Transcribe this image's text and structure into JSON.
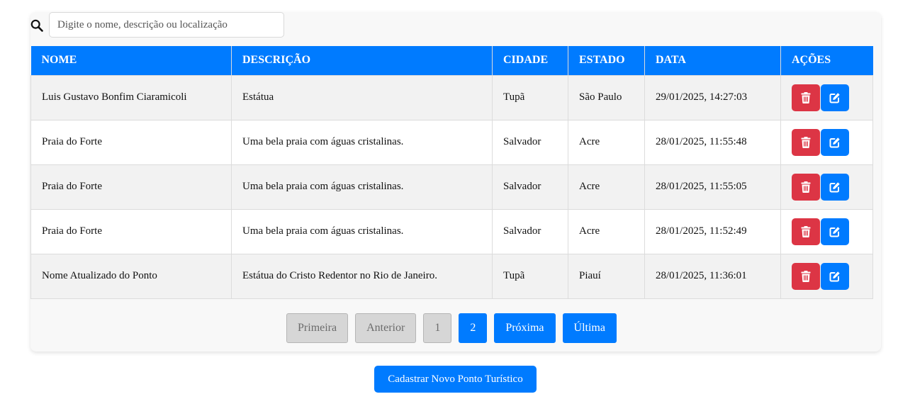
{
  "search": {
    "placeholder": "Digite o nome, descrição ou localização",
    "value": ""
  },
  "table": {
    "headers": [
      "NOME",
      "DESCRIÇÃO",
      "CIDADE",
      "ESTADO",
      "DATA",
      "AÇÕES"
    ],
    "rows": [
      {
        "nome": "Luis Gustavo Bonfim Ciaramicoli",
        "descricao": "Estátua",
        "cidade": "Tupã",
        "estado": "São Paulo",
        "data": "29/01/2025, 14:27:03"
      },
      {
        "nome": "Praia do Forte",
        "descricao": "Uma bela praia com águas cristalinas.",
        "cidade": "Salvador",
        "estado": "Acre",
        "data": "28/01/2025, 11:55:48"
      },
      {
        "nome": "Praia do Forte",
        "descricao": "Uma bela praia com águas cristalinas.",
        "cidade": "Salvador",
        "estado": "Acre",
        "data": "28/01/2025, 11:55:05"
      },
      {
        "nome": "Praia do Forte",
        "descricao": "Uma bela praia com águas cristalinas.",
        "cidade": "Salvador",
        "estado": "Acre",
        "data": "28/01/2025, 11:52:49"
      },
      {
        "nome": "Nome Atualizado do Ponto",
        "descricao": "Estátua do Cristo Redentor no Rio de Janeiro.",
        "cidade": "Tupã",
        "estado": "Piauí",
        "data": "28/01/2025, 11:36:01"
      }
    ],
    "row_actions": {
      "delete_icon": "trash-icon",
      "edit_icon": "edit-icon"
    }
  },
  "pagination": {
    "first": "Primeira",
    "previous": "Anterior",
    "pages": [
      "1",
      "2"
    ],
    "current_page": "2",
    "next": "Próxima",
    "last": "Última"
  },
  "footer": {
    "new_button": "Cadastrar Novo Ponto Turístico"
  },
  "colors": {
    "primary": "#007bff",
    "danger": "#dc3545",
    "disabled": "#d6d6d6"
  }
}
